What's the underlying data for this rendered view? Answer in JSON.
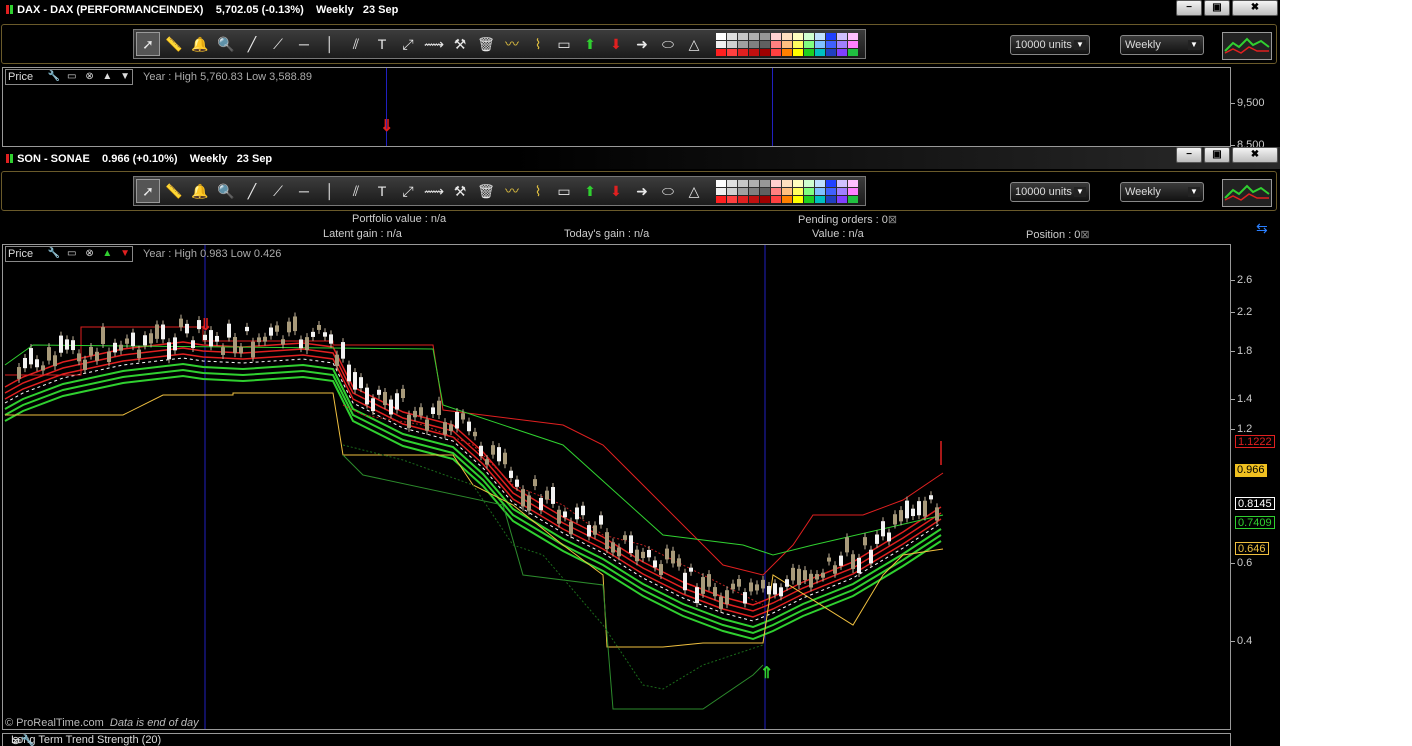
{
  "top_window": {
    "title": "DAX - DAX (PERFORMANCEINDEX)",
    "quote": "5,702.05 (-0.13%)",
    "period": "Weekly",
    "date": "23 Sep",
    "units_select": "10000 units",
    "timeframe_select": "Weekly",
    "pane_label": "Price",
    "year_info": "Year : High 5,760.83 Low 3,588.89",
    "axis_ticks": [
      "9,500",
      "8,500"
    ]
  },
  "bottom_window": {
    "title": "SON - SONAE",
    "quote": "0.966 (+0.10%)",
    "period": "Weekly",
    "date": "23 Sep",
    "units_select": "10000 units",
    "timeframe_select": "Weekly",
    "pane_label": "Price",
    "year_info": "Year : High 0.983 Low 0.426",
    "axis_ticks": [
      "2.6",
      "2.2",
      "1.8",
      "1.4",
      "1.2",
      "0.6",
      "0.4"
    ],
    "level_labels": [
      {
        "text": "1.1222",
        "color": "#e02020"
      },
      {
        "text": "0.966",
        "color": "#f0c020"
      },
      {
        "text": "0.8145",
        "color": "#ffffff"
      },
      {
        "text": "0.7409",
        "color": "#30d030"
      },
      {
        "text": "0.646",
        "color": "#f0c040"
      }
    ]
  },
  "portfolio": {
    "portfolio_value": "Portfolio value : n/a",
    "pending_orders": "Pending orders : 0",
    "latent_gain": "Latent gain : n/a",
    "todays_gain": "Today's gain : n/a",
    "value": "Value : n/a",
    "position": "Position : 0"
  },
  "footer": {
    "brand": "© ProRealTime.com",
    "note": "Data is end of day"
  },
  "indicator_pane": {
    "label": "Long Term Trend Strength (20)"
  },
  "window_buttons": {
    "minimize": "−",
    "restore": "▣",
    "close": "✖"
  },
  "colors": {
    "background": "#000000",
    "frame_gold": "#6a5a2a",
    "bullish": "#30d030",
    "bearish": "#e02020",
    "support": "#f0c040",
    "vertical_marker": "#2020c0"
  },
  "tools": [
    "pointer-icon",
    "ruler-icon",
    "alarm-icon",
    "zoom-icon",
    "line-icon",
    "trendline-icon",
    "horizontal-line-icon",
    "vertical-line-icon",
    "channel-icon",
    "text-icon",
    "fibonacci-icon",
    "fan-icon",
    "properties-icon",
    "delete-icon",
    "wave-icon",
    "zigzag-icon",
    "rectangle-icon",
    "buy-arrow-icon",
    "sell-arrow-icon",
    "right-arrow-icon",
    "ellipse-icon",
    "triangle-icon"
  ]
}
